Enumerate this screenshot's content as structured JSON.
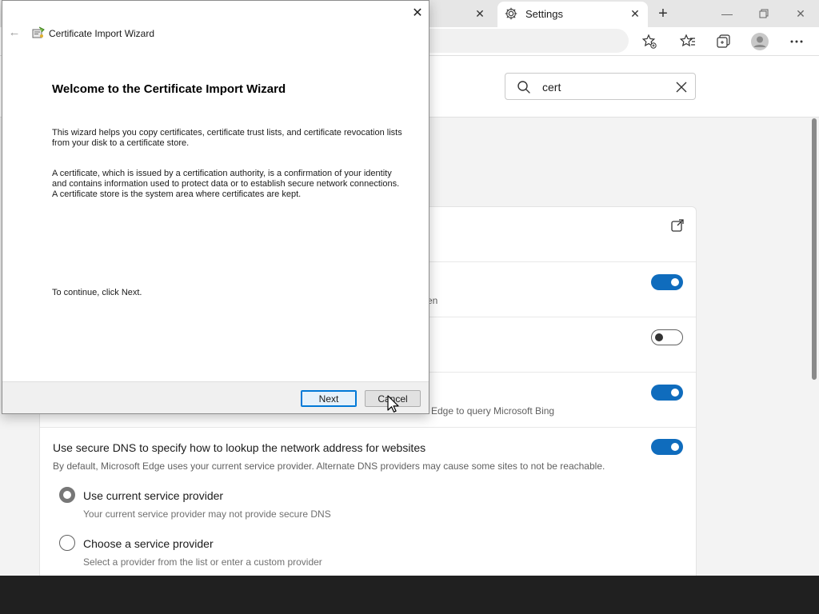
{
  "browser": {
    "tabs": [
      {
        "title": "",
        "active": false
      },
      {
        "title": "Settings",
        "active": true
      }
    ],
    "icons": [
      "close-icon",
      "gear-icon",
      "plus-icon",
      "minimize-icon",
      "restore-icon",
      "favorite-add-icon",
      "favorites-icon",
      "collections-icon",
      "profile-icon",
      "more-icon"
    ]
  },
  "settings": {
    "search": {
      "value": "cert"
    },
    "rows": [
      {
        "title": "",
        "desc": "",
        "has_external_link": true
      },
      {
        "title": "",
        "desc": "en",
        "toggle": "on"
      },
      {
        "title": "",
        "desc": "",
        "toggle": "off"
      },
      {
        "title": "",
        "desc": "Edge to query Microsoft Bing",
        "toggle": "on"
      },
      {
        "title": "Use secure DNS to specify how to lookup the network address for websites",
        "desc": "By default, Microsoft Edge uses your current service provider. Alternate DNS providers may cause some sites to not be reachable.",
        "toggle": "on"
      }
    ],
    "dns_options": [
      {
        "label": "Use current service provider",
        "desc": "Your current service provider may not provide secure DNS",
        "checked": true
      },
      {
        "label": "Choose a service provider",
        "desc": "Select a provider from the list or enter a custom provider",
        "checked": false
      }
    ]
  },
  "dialog": {
    "app_title": "Certificate Import Wizard",
    "heading": "Welcome to the Certificate Import Wizard",
    "para1": "This wizard helps you copy certificates, certificate trust lists, and certificate revocation lists from your disk to a certificate store.",
    "para2": "A certificate, which is issued by a certification authority, is a confirmation of your identity and contains information used to protect data or to establish secure network connections. A certificate store is the system area where certificates are kept.",
    "para3": "To continue, click Next.",
    "buttons": {
      "next": "Next",
      "cancel": "Cancel"
    }
  },
  "colors": {
    "accent": "#0f6cbd",
    "taskbar": "#202020"
  }
}
